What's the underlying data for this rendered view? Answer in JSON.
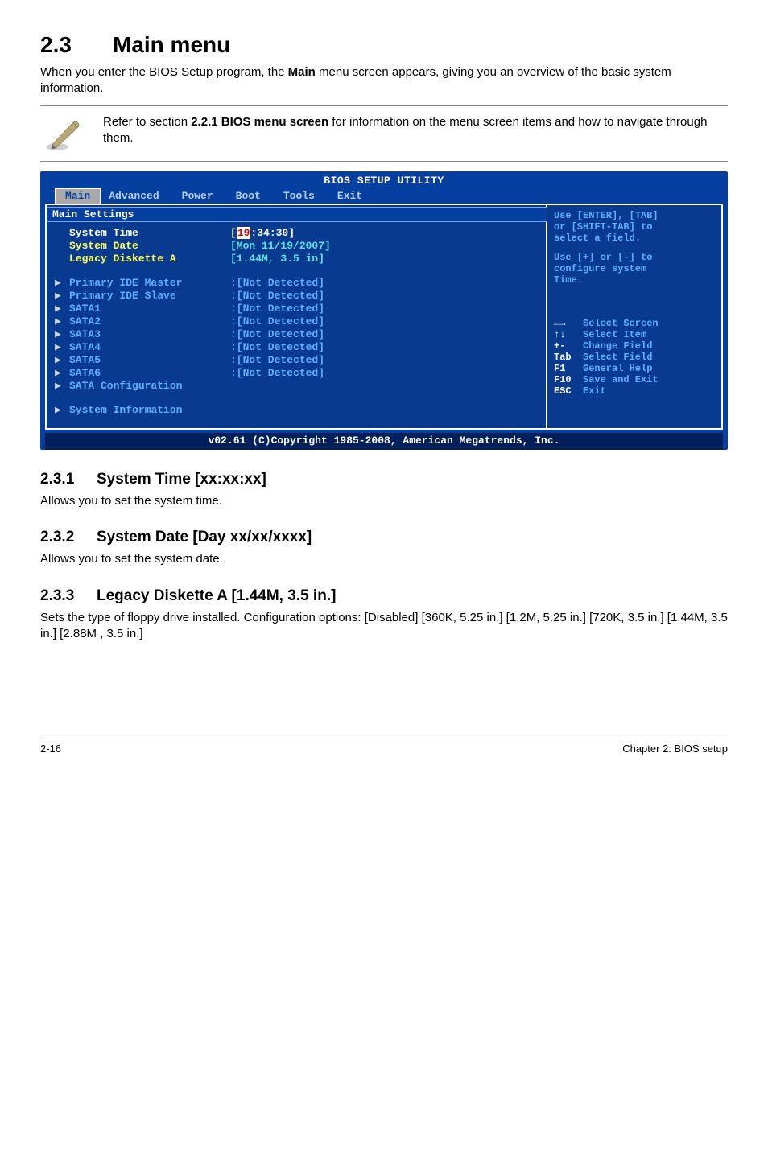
{
  "heading": {
    "num": "2.3",
    "title": "Main menu"
  },
  "intro": {
    "part1": "When you enter the BIOS Setup program, the ",
    "bold": "Main",
    "part2": " menu screen appears, giving you an overview of the basic system information."
  },
  "note": {
    "part1": "Refer to section ",
    "bold": "2.2.1 BIOS menu screen",
    "part2": " for information on the menu screen items and how to navigate through them."
  },
  "bios": {
    "title": "BIOS SETUP UTILITY",
    "tabs": [
      "Main",
      "Advanced",
      "Power",
      "Boot",
      "Tools",
      "Exit"
    ],
    "section_header": "Main Settings",
    "fields": [
      {
        "name": "system-time",
        "label": "System Time",
        "value": "[19:34:30]",
        "highlight_hour": "19",
        "selected": true
      },
      {
        "name": "system-date",
        "label": "System Date",
        "value": "[Mon 11/19/2007]"
      },
      {
        "name": "legacy-diskette-a",
        "label": "Legacy Diskette A",
        "value": "[1.44M, 3.5 in]"
      }
    ],
    "items": [
      {
        "name": "primary-ide-master",
        "label": "Primary IDE Master",
        "value": ":[Not Detected]"
      },
      {
        "name": "primary-ide-slave",
        "label": "Primary IDE Slave",
        "value": ":[Not Detected]"
      },
      {
        "name": "sata1",
        "label": "SATA1",
        "value": ":[Not Detected]"
      },
      {
        "name": "sata2",
        "label": "SATA2",
        "value": ":[Not Detected]"
      },
      {
        "name": "sata3",
        "label": "SATA3",
        "value": ":[Not Detected]"
      },
      {
        "name": "sata4",
        "label": "SATA4",
        "value": ":[Not Detected]"
      },
      {
        "name": "sata5",
        "label": "SATA5",
        "value": ":[Not Detected]"
      },
      {
        "name": "sata6",
        "label": "SATA6",
        "value": ":[Not Detected]"
      },
      {
        "name": "sata-configuration",
        "label": "SATA Configuration",
        "value": ""
      }
    ],
    "extra_item": {
      "name": "system-information",
      "label": "System Information",
      "value": ""
    },
    "help": {
      "line1": "Use [ENTER], [TAB]",
      "line2": "or [SHIFT-TAB] to",
      "line3": "select a field.",
      "line4": "Use [+] or [-] to",
      "line5": "configure system",
      "line6": "Time.",
      "keys": [
        {
          "key": "←→",
          "desc": "Select Screen"
        },
        {
          "key": "↑↓",
          "desc": "Select Item"
        },
        {
          "key": "+-",
          "desc": "Change Field"
        },
        {
          "key": "Tab",
          "desc": "Select Field"
        },
        {
          "key": "F1",
          "desc": "General Help"
        },
        {
          "key": "F10",
          "desc": "Save and Exit"
        },
        {
          "key": "ESC",
          "desc": "Exit"
        }
      ]
    },
    "footer": "v02.61 (C)Copyright 1985-2008, American Megatrends, Inc."
  },
  "sections": [
    {
      "num": "2.3.1",
      "title": "System Time [xx:xx:xx]",
      "body": "Allows you to set the system time."
    },
    {
      "num": "2.3.2",
      "title": "System Date [Day xx/xx/xxxx]",
      "body": "Allows you to set the system date."
    },
    {
      "num": "2.3.3",
      "title": "Legacy Diskette A [1.44M, 3.5 in.]",
      "body": "Sets the type of floppy drive installed. Configuration options: [Disabled] [360K, 5.25 in.] [1.2M, 5.25 in.] [720K, 3.5 in.] [1.44M, 3.5 in.] [2.88M , 3.5 in.]"
    }
  ],
  "footer": {
    "left": "2-16",
    "right": "Chapter 2: BIOS setup"
  }
}
